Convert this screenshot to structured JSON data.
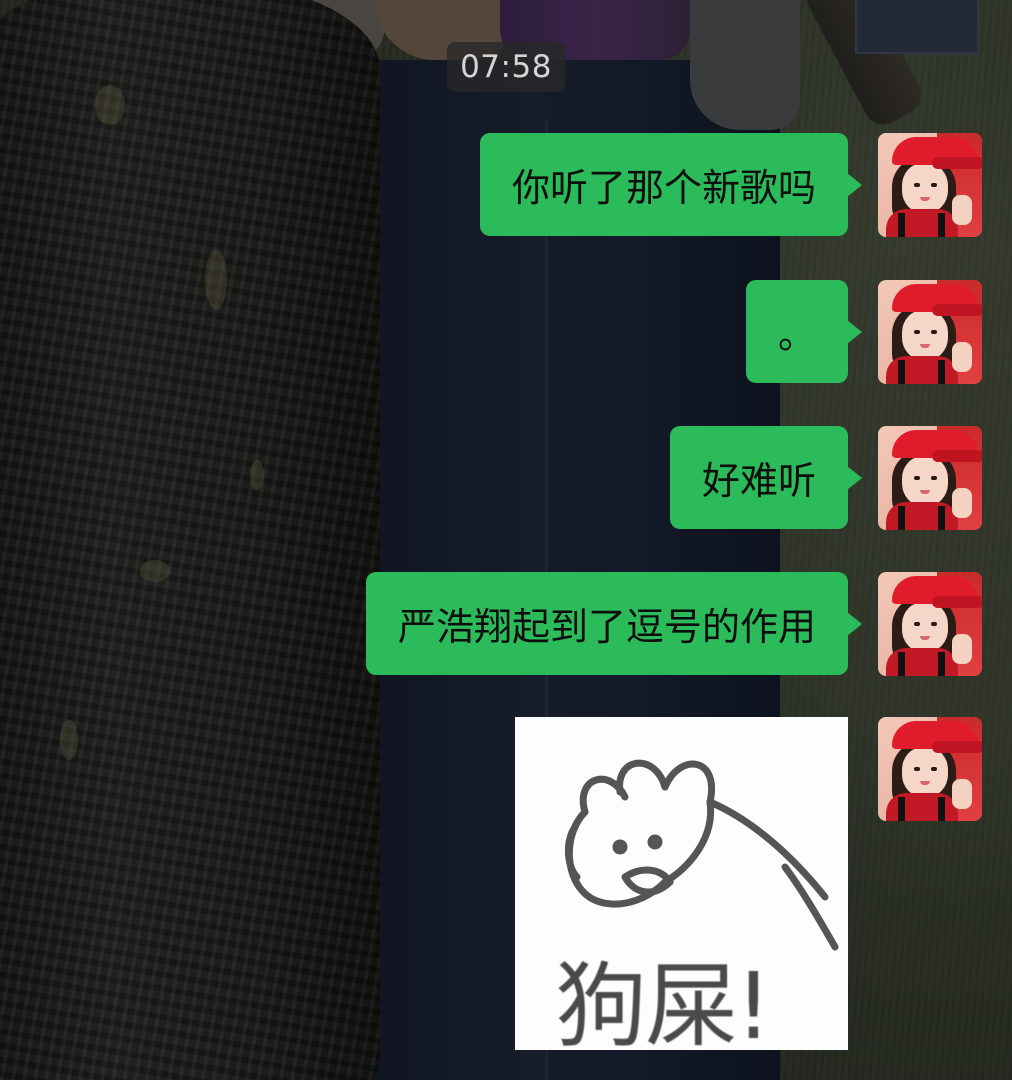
{
  "chat": {
    "timestamp": "07:58",
    "messages": [
      {
        "text": "你听了那个新歌吗"
      },
      {
        "text": "。"
      },
      {
        "text": "好难听"
      },
      {
        "text": "严浩翔起到了逗号的作用"
      }
    ],
    "sticker": {
      "icon": "rabbit-sticker-icon",
      "text": "狗屎!"
    }
  },
  "colors": {
    "bubble": "#2bbb5a",
    "bubble_text": "#0e0e0e",
    "time_pill_bg": "#282828",
    "time_pill_text": "#d5d5d5"
  }
}
